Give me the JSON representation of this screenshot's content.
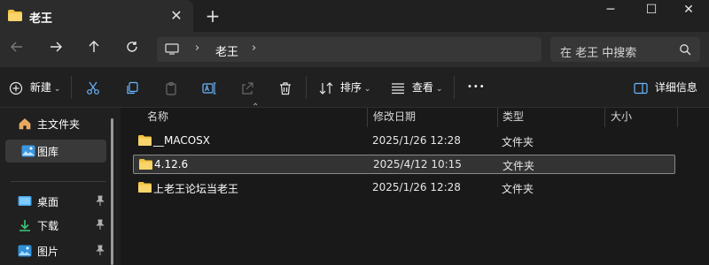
{
  "window": {
    "tab_title": "老王",
    "new_tab_symbol": "+",
    "controls": {
      "minimize": "─",
      "maximize": "☐",
      "close": "✕"
    }
  },
  "address": {
    "crumbs": [
      "老王"
    ],
    "separator": "›",
    "search_placeholder": "在 老王 中搜索"
  },
  "commands": {
    "new_label": "新建",
    "sort_label": "排序",
    "view_label": "查看",
    "more_symbol": "•••",
    "details_label": "详细信息"
  },
  "nav": {
    "items": [
      {
        "label": "主文件夹",
        "icon": "home-icon",
        "selected": false,
        "pinned": false
      },
      {
        "label": "图库",
        "icon": "gallery-icon",
        "selected": true,
        "pinned": false
      },
      {
        "label": "桌面",
        "icon": "desktop-icon",
        "selected": false,
        "pinned": true
      },
      {
        "label": "下载",
        "icon": "download-icon",
        "selected": false,
        "pinned": true
      },
      {
        "label": "图片",
        "icon": "pictures-icon",
        "selected": false,
        "pinned": true
      }
    ]
  },
  "files": {
    "columns": [
      "名称",
      "修改日期",
      "类型",
      "大小"
    ],
    "rows": [
      {
        "name": "__MACOSX",
        "modified": "2025/1/26 12:28",
        "type": "文件夹",
        "size": "",
        "selected": false
      },
      {
        "name": "4.12.6",
        "modified": "2025/4/12 10:15",
        "type": "文件夹",
        "size": "",
        "selected": true
      },
      {
        "name": "上老王论坛当老王",
        "modified": "2025/1/26 12:28",
        "type": "文件夹",
        "size": "",
        "selected": false
      }
    ]
  },
  "colors": {
    "folder": "#f5c242",
    "accent": "#4cc2ff",
    "background": "#191919",
    "chrome": "#202020"
  }
}
